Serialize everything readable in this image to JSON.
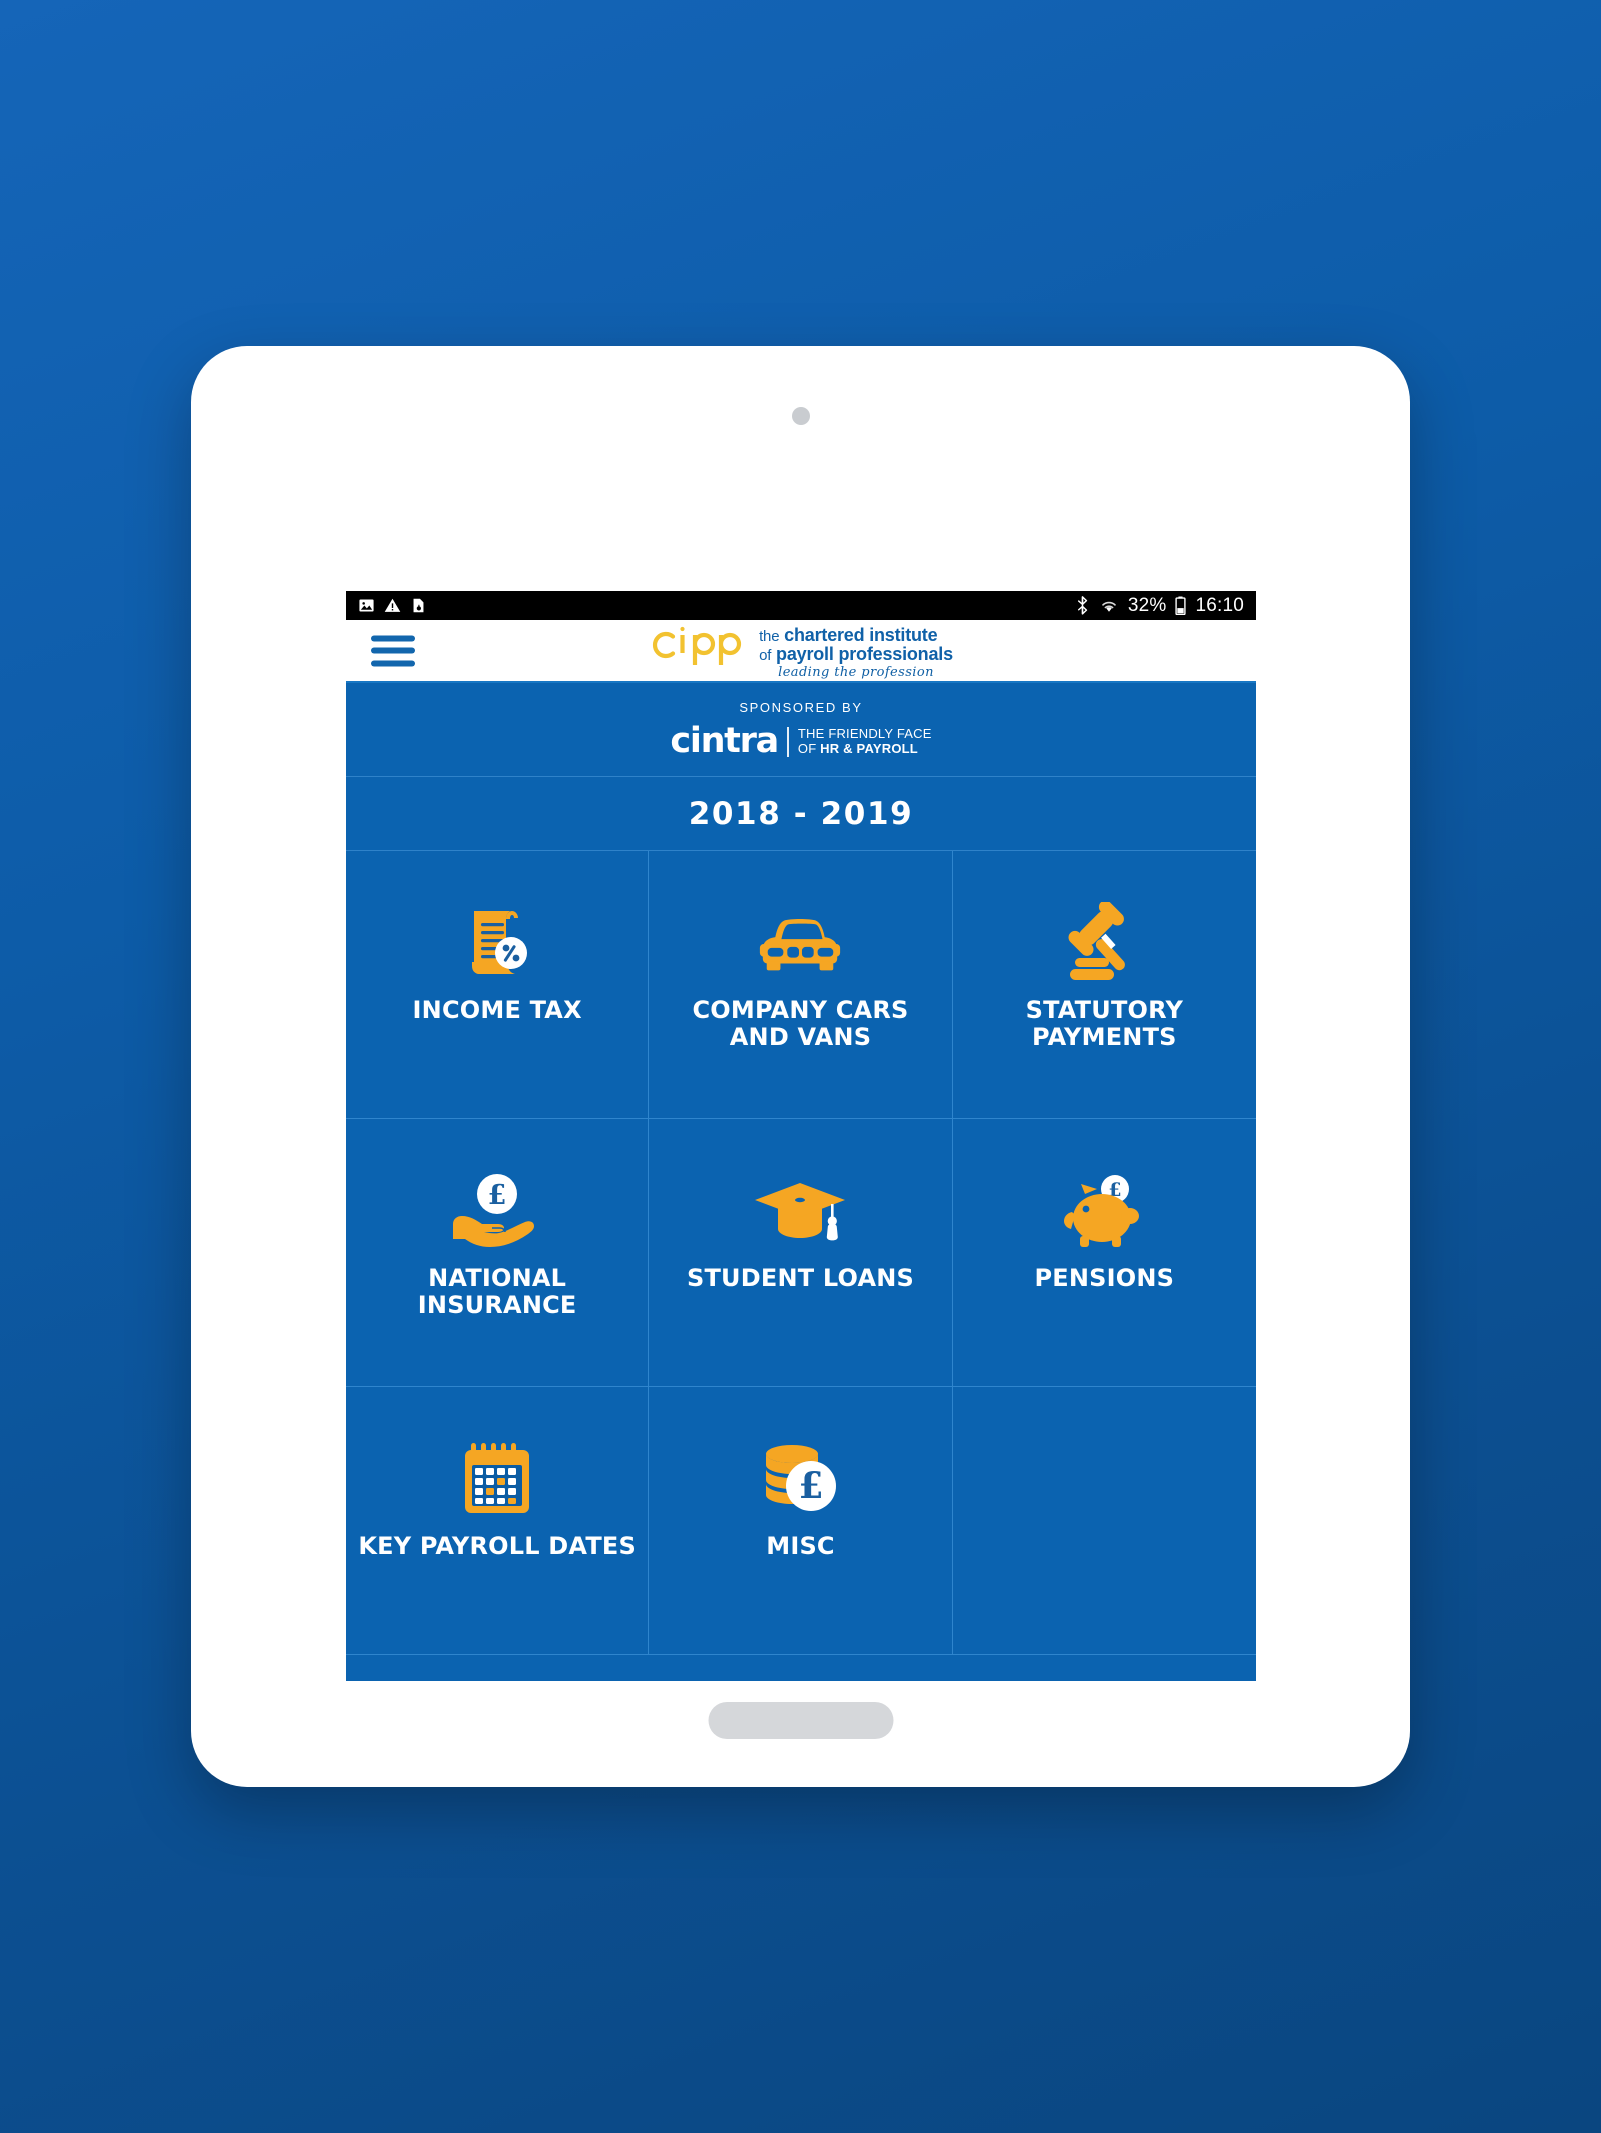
{
  "status_bar": {
    "left_icons": [
      "image-icon",
      "warning-icon",
      "file-download-icon"
    ],
    "right_icons": [
      "bluetooth-icon",
      "wifi-icon",
      "battery-icon"
    ],
    "battery_percent": "32%",
    "time": "16:10"
  },
  "header": {
    "menu_icon": "hamburger-menu-icon",
    "logo_mark": "cipp",
    "logo_line1_thin": "the",
    "logo_line1_bold": "chartered institute",
    "logo_line2_thin": "of",
    "logo_line2_bold": "payroll professionals",
    "logo_tagline": "leading the profession"
  },
  "sponsor": {
    "label": "SPONSORED BY",
    "brand": "cintra",
    "strapline_1": "THE FRIENDLY FACE",
    "strapline_2_thin": "OF ",
    "strapline_2_bold": "HR & PAYROLL"
  },
  "year_bar": {
    "title": "2018 - 2019"
  },
  "grid": {
    "tiles": [
      {
        "label": "INCOME TAX",
        "icon": "tax-scroll-percent-icon",
        "empty": false
      },
      {
        "label": "COMPANY CARS AND VANS",
        "icon": "car-front-icon",
        "empty": false
      },
      {
        "label": "STATUTORY PAYMENTS",
        "icon": "gavel-icon",
        "empty": false
      },
      {
        "label": "NATIONAL INSURANCE",
        "icon": "hand-holding-pound-coin-icon",
        "empty": false
      },
      {
        "label": "STUDENT LOANS",
        "icon": "graduation-cap-icon",
        "empty": false
      },
      {
        "label": "PENSIONS",
        "icon": "piggy-bank-pound-icon",
        "empty": false
      },
      {
        "label": "KEY PAYROLL DATES",
        "icon": "calendar-icon",
        "empty": false
      },
      {
        "label": "MISC",
        "icon": "coin-stack-pound-icon",
        "empty": false
      },
      {
        "label": "",
        "icon": "",
        "empty": true
      }
    ]
  },
  "colors": {
    "screen_blue": "#0b63b0",
    "grid_line": "#2f85cd",
    "icon_gold": "#f5a623",
    "icon_white": "#ffffff",
    "logo_blue": "#1061a8",
    "logo_gold": "#f2c230",
    "page_background": "#0d5ca8"
  },
  "device": {
    "camera": "front-camera",
    "home_button": "home-button"
  }
}
